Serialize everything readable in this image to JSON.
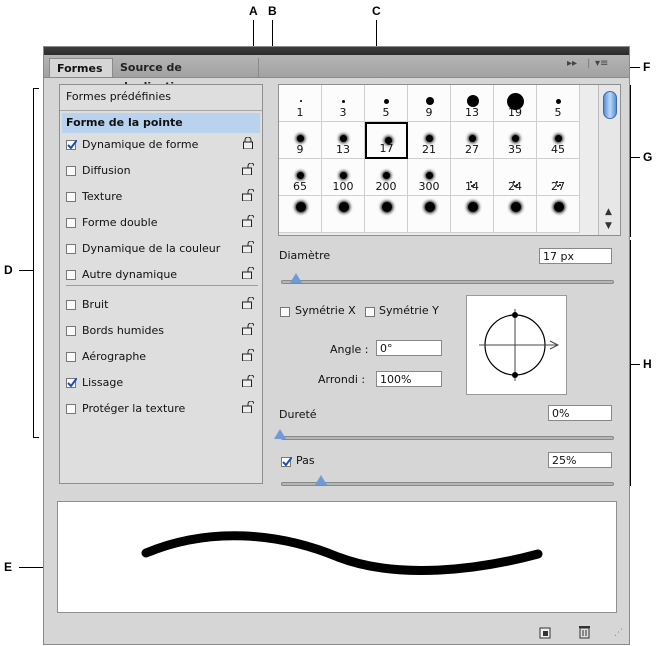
{
  "callouts": {
    "A": "A",
    "B": "B",
    "C": "C",
    "D": "D",
    "E": "E",
    "F": "F",
    "G": "G",
    "H": "H"
  },
  "tabs": [
    {
      "label": "Formes"
    },
    {
      "label": "Source de duplication"
    }
  ],
  "left_panel": {
    "presets_label": "Formes prédéfinies",
    "tip_label": "Forme de la pointe",
    "options": [
      {
        "label": "Dynamique de forme",
        "checked": true,
        "locked": true
      },
      {
        "label": "Diffusion",
        "checked": false,
        "locked": false
      },
      {
        "label": "Texture",
        "checked": false,
        "locked": false
      },
      {
        "label": "Forme double",
        "checked": false,
        "locked": false
      },
      {
        "label": "Dynamique de la couleur",
        "checked": false,
        "locked": false
      },
      {
        "label": "Autre dynamique",
        "checked": false,
        "locked": false
      },
      {
        "label": "Bruit",
        "checked": false,
        "locked": false
      },
      {
        "label": "Bords humides",
        "checked": false,
        "locked": false
      },
      {
        "label": "Aérographe",
        "checked": false,
        "locked": false
      },
      {
        "label": "Lissage",
        "checked": true,
        "locked": false
      },
      {
        "label": "Protéger la texture",
        "checked": false,
        "locked": false
      }
    ]
  },
  "brush_grid": {
    "rows": [
      [
        "1",
        "3",
        "5",
        "9",
        "13",
        "19",
        "5"
      ],
      [
        "9",
        "13",
        "17",
        "21",
        "27",
        "35",
        "45"
      ],
      [
        "65",
        "100",
        "200",
        "300",
        "14",
        "24",
        "27"
      ],
      [
        "",
        "",
        "",
        "",
        "",
        "",
        ""
      ]
    ],
    "selected": "17"
  },
  "controls": {
    "diameter_label": "Diamètre",
    "diameter_value": "17 px",
    "flip_x_label": "Symétrie X",
    "flip_y_label": "Symétrie Y",
    "angle_label": "Angle :",
    "angle_value": "0°",
    "roundness_label": "Arrondi :",
    "roundness_value": "100%",
    "hardness_label": "Dureté",
    "hardness_value": "0%",
    "spacing_label": "Pas",
    "spacing_value": "25%",
    "spacing_checked": true
  },
  "colors": {
    "selected_row": "#b9d2ee",
    "slider_knob": "#6e9ad6",
    "scroll_thumb": "#5a8fd8"
  }
}
